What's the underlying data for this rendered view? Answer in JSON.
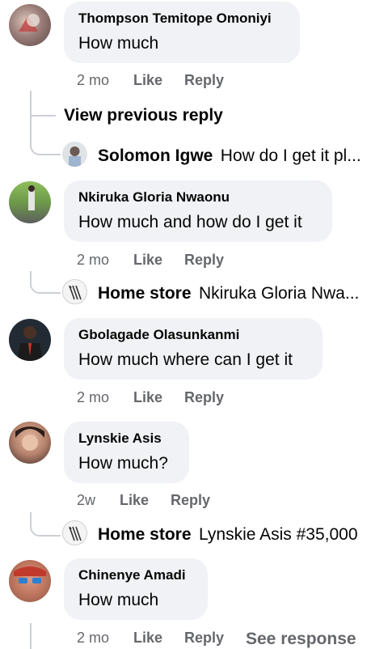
{
  "comments": [
    {
      "name": "Thompson Temitope Omoniyi",
      "text": "How much",
      "age": "2 mo",
      "like": "Like",
      "reply": "Reply"
    },
    {
      "name": "Nkiruka Gloria Nwaonu",
      "text": "How much and how do I get it",
      "age": "2 mo",
      "like": "Like",
      "reply": "Reply"
    },
    {
      "name": "Gbolagade Olasunkanmi",
      "text": "How much where can I get it",
      "age": "2 mo",
      "like": "Like",
      "reply": "Reply"
    },
    {
      "name": "Lynskie Asis",
      "text": "How much?",
      "age": "2w",
      "like": "Like",
      "reply": "Reply"
    },
    {
      "name": "Chinenye Amadi",
      "text": "How much",
      "age": "2 mo",
      "like": "Like",
      "reply": "Reply",
      "see_response": "See response"
    }
  ],
  "view_previous": "View previous reply",
  "replies": [
    {
      "name": "Solomon Igwe",
      "text": "How do I get it pl..."
    },
    {
      "name": "Home store",
      "text": "Nkiruka Gloria Nwa..."
    },
    {
      "name": "Home store",
      "text": "Lynskie Asis #35,000"
    }
  ]
}
